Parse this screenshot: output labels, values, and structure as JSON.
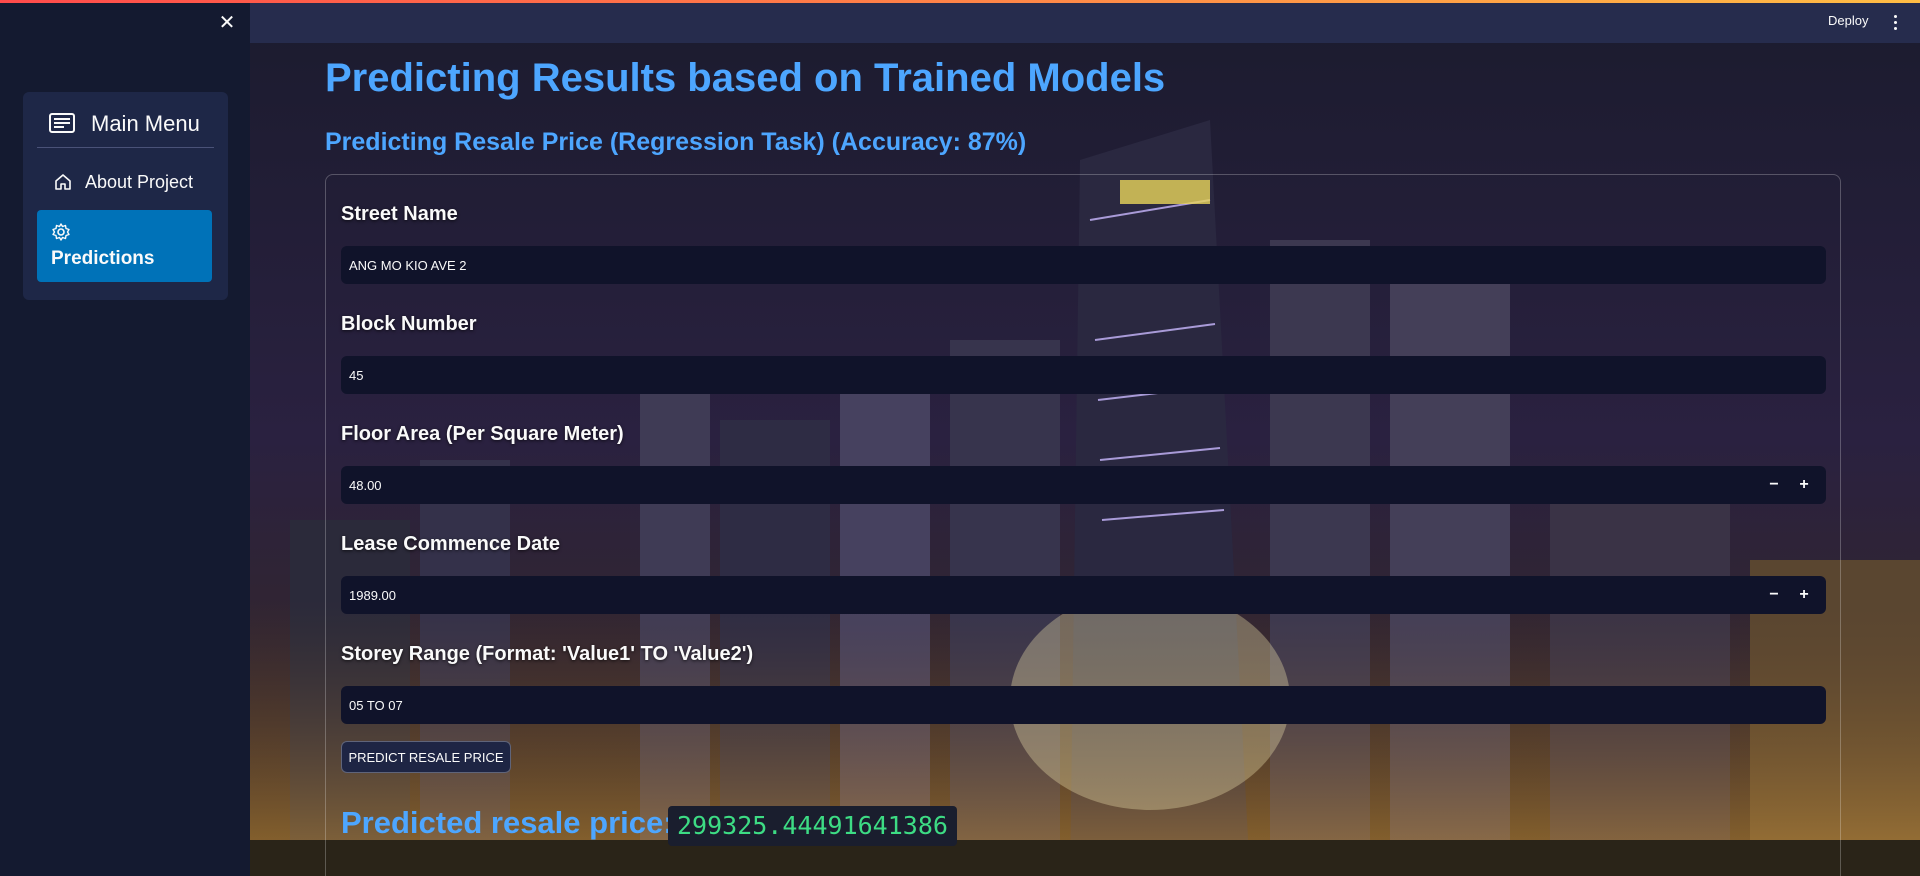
{
  "sidebar": {
    "close_icon": "close-icon",
    "menu_title": "Main Menu",
    "menu_icon": "menu-list-icon",
    "items": [
      {
        "label": "About Project",
        "icon": "home-icon",
        "active": false
      },
      {
        "label": "Predictions",
        "icon": "gear-icon",
        "active": true
      }
    ]
  },
  "header": {
    "deploy_label": "Deploy",
    "menu_icon": "kebab-menu-icon"
  },
  "main": {
    "title": "Predicting Results based on Trained Models",
    "subtitle": "Predicting Resale Price (Regression Task) (Accuracy: 87%)",
    "fields": {
      "street_name": {
        "label": "Street Name",
        "value": "ANG MO KIO AVE 2"
      },
      "block_number": {
        "label": "Block Number",
        "value": "45"
      },
      "floor_area": {
        "label": "Floor Area (Per Square Meter)",
        "value": "48.00",
        "decrement": "−",
        "increment": "+"
      },
      "lease_date": {
        "label": "Lease Commence Date",
        "value": "1989.00",
        "decrement": "−",
        "increment": "+"
      },
      "storey_range": {
        "label": "Storey Range (Format: 'Value1' TO 'Value2')",
        "value": "05 TO 07"
      }
    },
    "predict_button": "PREDICT RESALE PRICE",
    "result_label": "Predicted resale price:",
    "result_value": "299325.44491641386"
  },
  "colors": {
    "accent": "#4da6ff",
    "sidebar_active": "#0072b8",
    "result_text": "#3ddc84",
    "sidebar_bg": "#141a30",
    "header_bg": "#262c4d"
  }
}
